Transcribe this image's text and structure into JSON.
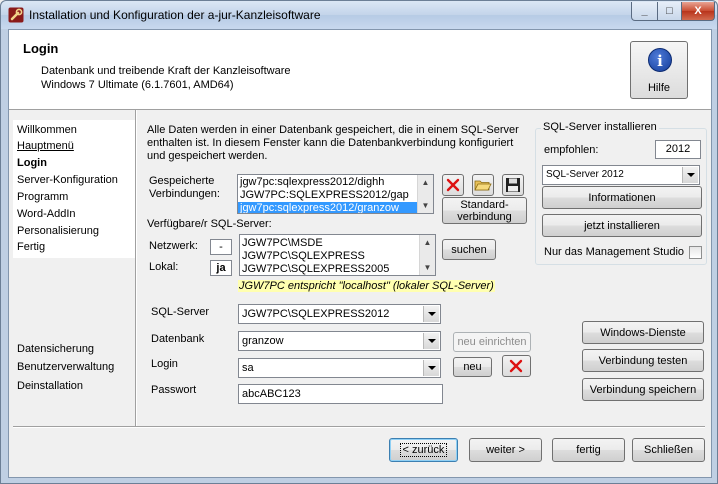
{
  "window": {
    "title": "Installation und Konfiguration der a-jur-Kanzleisoftware",
    "minimize": "_",
    "maximize": "□",
    "close": "X"
  },
  "header": {
    "title": "Login",
    "line1": "Datenbank und treibende Kraft der Kanzleisoftware",
    "line2": "Windows 7 Ultimate (6.1.7601, AMD64)",
    "help_symbol": "i",
    "help_label": "Hilfe"
  },
  "nav": {
    "items": [
      {
        "label": "Willkommen",
        "style": "plain"
      },
      {
        "label": "Hauptmenü",
        "style": "link"
      },
      {
        "label": "Login",
        "style": "active"
      },
      {
        "label": "Server-Konfiguration",
        "style": "plain"
      },
      {
        "label": "Programm",
        "style": "plain"
      },
      {
        "label": "Word-AddIn",
        "style": "plain"
      },
      {
        "label": "Personalisierung",
        "style": "plain"
      },
      {
        "label": "Fertig",
        "style": "plain"
      }
    ],
    "bottom_items": [
      "Datensicherung",
      "Benutzerverwaltung",
      "Deinstallation"
    ]
  },
  "main": {
    "info": "Alle Daten werden in einer Datenbank gespeichert, die in einem SQL-Server enthalten ist. In diesem Fenster kann die Datenbankverbindung konfiguriert und gespeichert werden.",
    "saved_connections_label_1": "Gespeicherte",
    "saved_connections_label_2": "Verbindungen:",
    "saved_connections": [
      {
        "text": "jgw7pc:sqlexpress2012/dighh",
        "selected": false
      },
      {
        "text": "JGW7PC:SQLEXPRESS2012/gap",
        "selected": false
      },
      {
        "text": "jgw7pc:sqlexpress2012/granzow",
        "selected": true
      }
    ],
    "standard_connection_label_1": "Standard-",
    "standard_connection_label_2": "verbindung",
    "available_servers_label": "Verfügbare/r SQL-Server:",
    "network_label": "Netzwerk:",
    "network_value": "-",
    "local_label": "Lokal:",
    "local_value": "ja",
    "servers": [
      "JGW7PC\\MSDE",
      "JGW7PC\\SQLEXPRESS",
      "JGW7PC\\SQLEXPRESS2005"
    ],
    "search_label": "suchen",
    "hint": "JGW7PC entspricht \"localhost\" (lokaler SQL-Server)",
    "sqlserver_label": "SQL-Server",
    "sqlserver_value": "JGW7PC\\SQLEXPRESS2012",
    "database_label": "Datenbank",
    "database_value": "granzow",
    "new_setup_label": "neu einrichten",
    "login_label": "Login",
    "login_value": "sa",
    "new_label": "neu",
    "password_label": "Passwort",
    "password_value": "abcABC123"
  },
  "sql_install": {
    "title": "SQL-Server installieren",
    "recommended_label": "empfohlen:",
    "recommended_value": "2012",
    "version_value": "SQL-Server 2012",
    "info_button": "Informationen",
    "install_button": "jetzt installieren",
    "mgmt_only_label": "Nur das Management Studio"
  },
  "right_buttons": {
    "windows_services": "Windows-Dienste",
    "test_connection": "Verbindung testen",
    "save_connection": "Verbindung speichern"
  },
  "footer": {
    "back": "< zurück",
    "next": "weiter >",
    "finish": "fertig",
    "close": "Schließen"
  }
}
